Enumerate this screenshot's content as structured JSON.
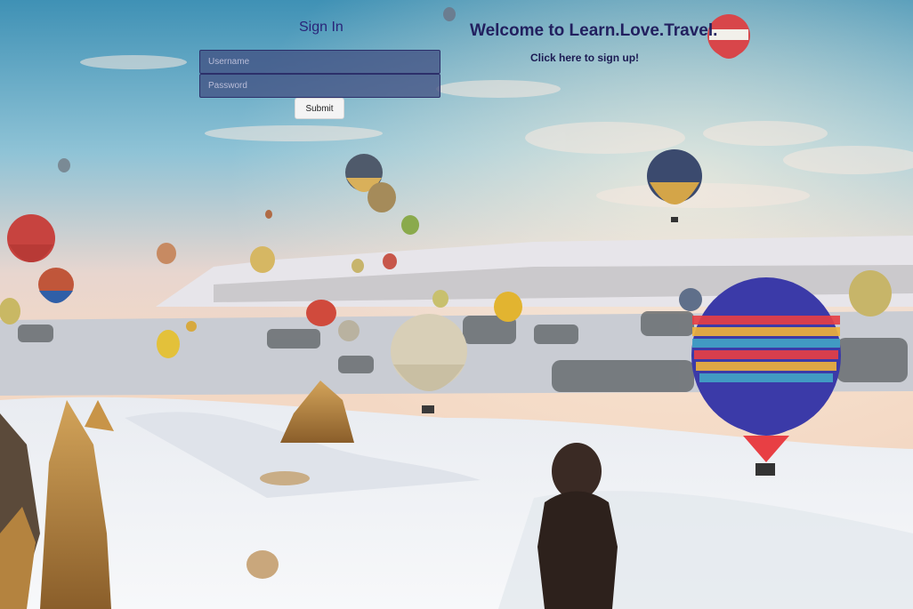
{
  "signin": {
    "title": "Sign In",
    "username_placeholder": "Username",
    "password_placeholder": "Password",
    "submit_label": "Submit"
  },
  "welcome": {
    "heading": "Welcome to Learn.Love.Travel.",
    "signup_link": "Click here to sign up!"
  },
  "background": {
    "scene": "hot-air-balloons-over-snowy-valley",
    "sky_color": "#8fc3d6",
    "snow_color": "#f2f4f7"
  }
}
